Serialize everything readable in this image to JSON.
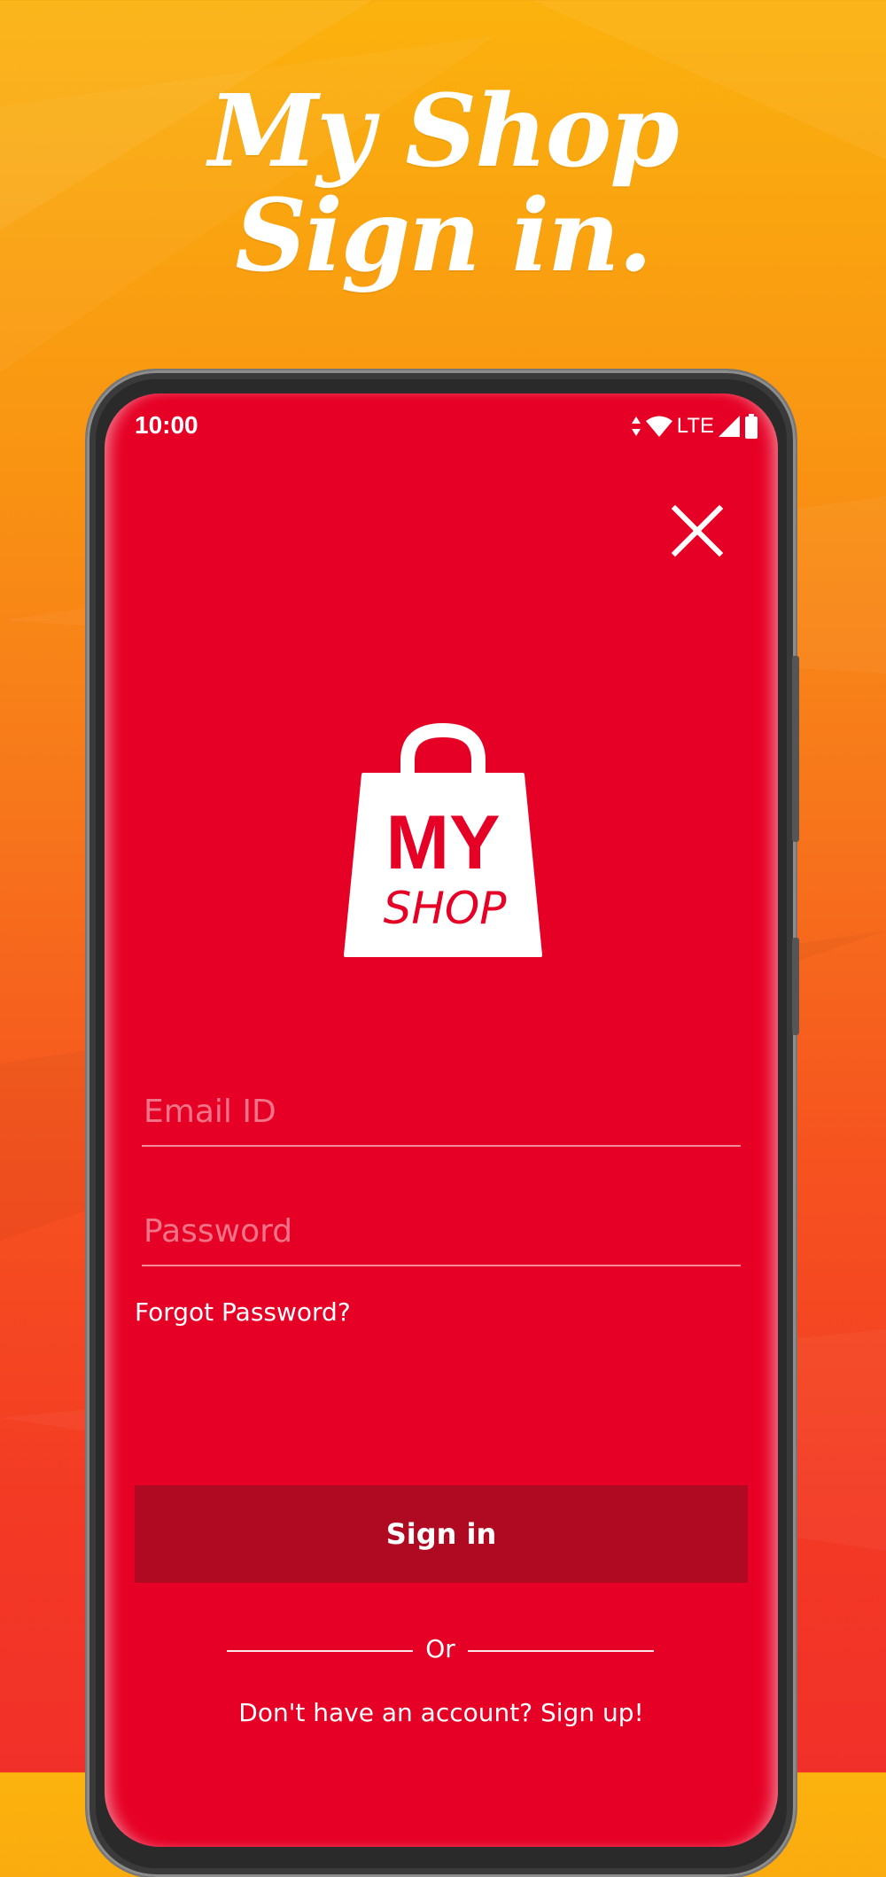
{
  "headline": {
    "line1": "My Shop",
    "line2": "Sign in."
  },
  "status_bar": {
    "time": "10:00",
    "network": "LTE",
    "icons": [
      "data-arrows-icon",
      "wifi-icon",
      "lte-label",
      "signal-icon",
      "battery-icon"
    ]
  },
  "logo": {
    "top_text": "MY",
    "bottom_text": "SHOP"
  },
  "form": {
    "email_placeholder": "Email ID",
    "email_value": "",
    "password_placeholder": "Password",
    "password_value": "",
    "forgot_label": "Forgot Password?",
    "signin_label": "Sign in",
    "or_label": "Or",
    "signup_label": "Don't have an account? Sign up!"
  },
  "colors": {
    "screen_background": "#e60025",
    "button_background": "#b00a22",
    "page_gradient_top": "#fbb20e",
    "page_gradient_bottom": "#f2302a"
  }
}
